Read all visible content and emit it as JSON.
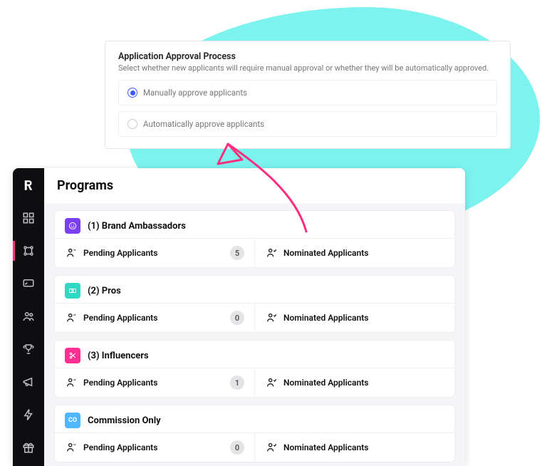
{
  "approval": {
    "title": "Application Approval Process",
    "subtitle": "Select whether new applicants will require manual approval or whether they will be automatically approved.",
    "options": [
      {
        "label": "Manually approve applicants",
        "selected": true
      },
      {
        "label": "Automatically approve applicants",
        "selected": false
      }
    ]
  },
  "header": {
    "title": "Programs"
  },
  "programs": [
    {
      "name": "(1) Brand Ambassadors",
      "icon": "smile-icon",
      "icon_color": "#7B3FF2",
      "pending": {
        "label": "Pending Applicants",
        "count": 5
      },
      "nominated": {
        "label": "Nominated Applicants"
      }
    },
    {
      "name": "(2) Pros",
      "icon": "cash-icon",
      "icon_color": "#2FD9C4",
      "pending": {
        "label": "Pending Applicants",
        "count": 0
      },
      "nominated": {
        "label": "Nominated Applicants"
      }
    },
    {
      "name": "(3) Influencers",
      "icon": "scissors-icon",
      "icon_color": "#FF2E92",
      "pending": {
        "label": "Pending Applicants",
        "count": 1
      },
      "nominated": {
        "label": "Nominated Applicants"
      }
    },
    {
      "name": "Commission Only",
      "icon": "text-icon",
      "icon_text": "CO",
      "icon_color": "#4FB6FF",
      "pending": {
        "label": "Pending Applicants",
        "count": 0
      },
      "nominated": {
        "label": "Nominated Applicants"
      }
    }
  ],
  "sidebar": {
    "items": [
      "dashboard",
      "programs",
      "broadcast",
      "members",
      "rewards",
      "announce",
      "automation",
      "gifts"
    ]
  },
  "accent": {
    "pink": "#FF2E7E"
  }
}
